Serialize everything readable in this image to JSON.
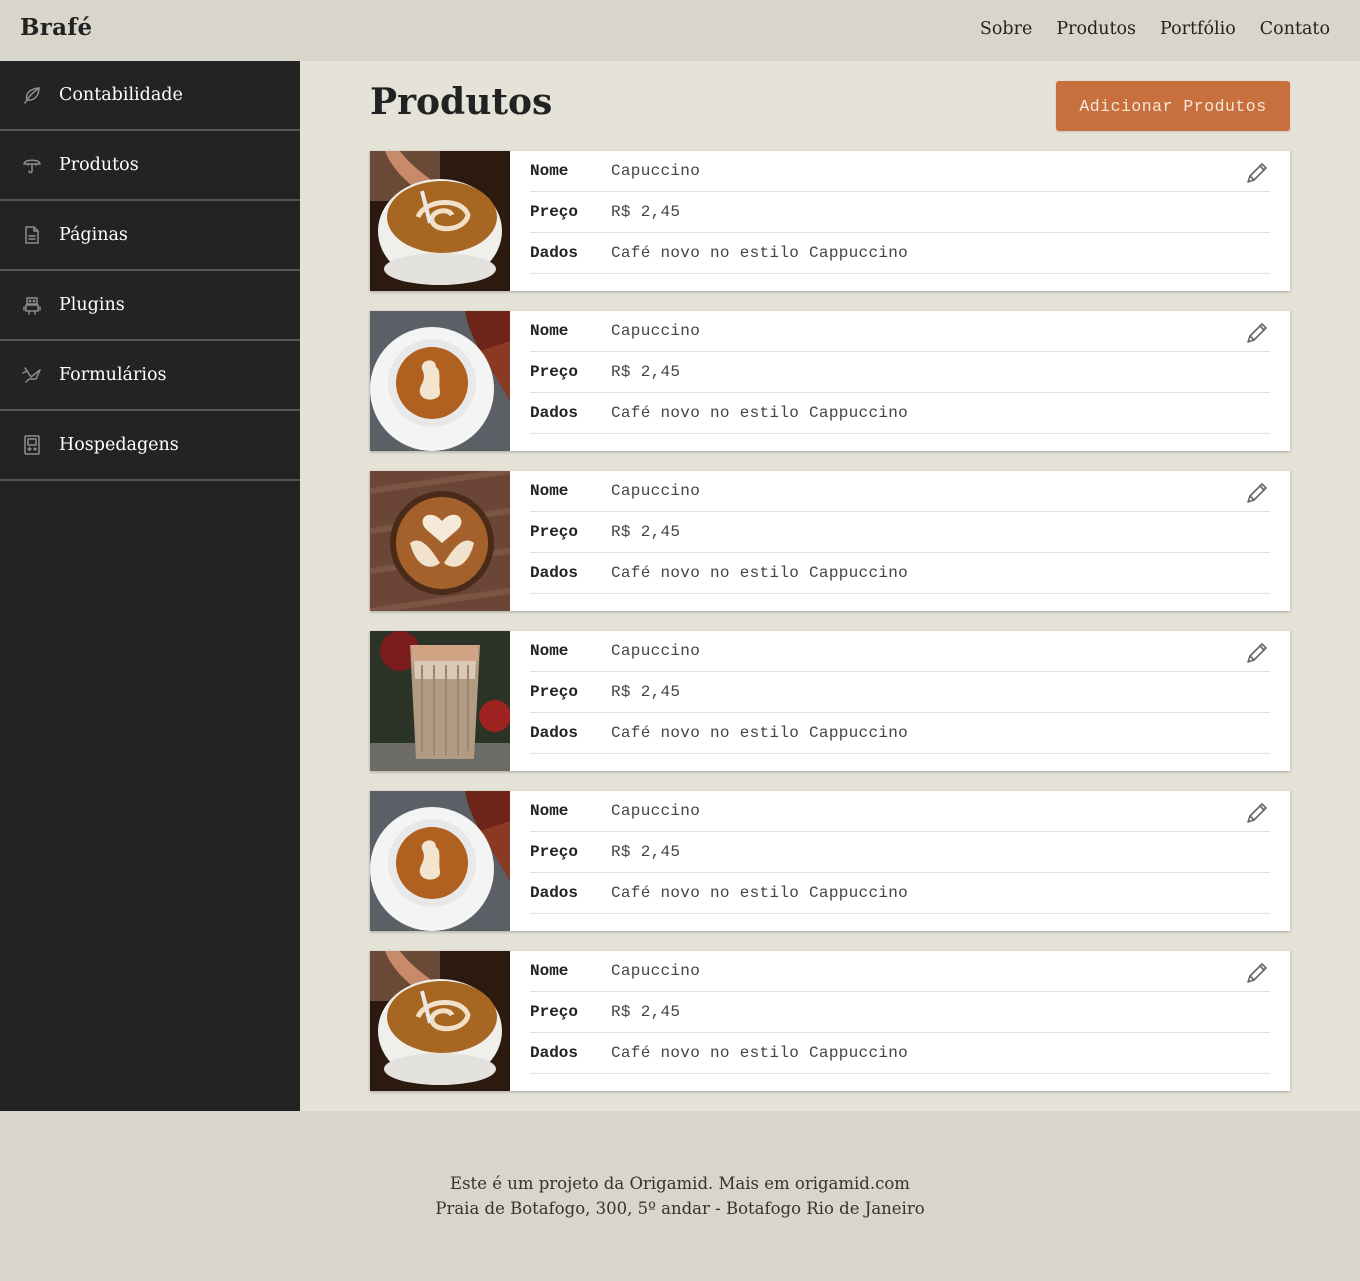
{
  "header": {
    "brand": "Brafé",
    "nav": [
      "Sobre",
      "Produtos",
      "Portfólio",
      "Contato"
    ]
  },
  "sidebar": {
    "items": [
      {
        "label": "Contabilidade",
        "icon": "leaf-icon"
      },
      {
        "label": "Produtos",
        "icon": "umbrella-icon"
      },
      {
        "label": "Páginas",
        "icon": "document-icon"
      },
      {
        "label": "Plugins",
        "icon": "robot-icon"
      },
      {
        "label": "Formulários",
        "icon": "bird-icon"
      },
      {
        "label": "Hospedagens",
        "icon": "gameboy-icon"
      }
    ]
  },
  "main": {
    "title": "Produtos",
    "add_button": "Adicionar Produtos",
    "field_labels": {
      "name": "Nome",
      "price": "Preço",
      "data": "Dados"
    },
    "products": [
      {
        "name": "Capuccino",
        "price": "R$ 2,45",
        "data": "Café novo no estilo Cappuccino",
        "image": "latte-art-pour"
      },
      {
        "name": "Capuccino",
        "price": "R$ 2,45",
        "data": "Café novo no estilo Cappuccino",
        "image": "latte-saucer"
      },
      {
        "name": "Capuccino",
        "price": "R$ 2,45",
        "data": "Café novo no estilo Cappuccino",
        "image": "latte-heart-wood"
      },
      {
        "name": "Capuccino",
        "price": "R$ 2,45",
        "data": "Café novo no estilo Cappuccino",
        "image": "iced-latte-glass"
      },
      {
        "name": "Capuccino",
        "price": "R$ 2,45",
        "data": "Café novo no estilo Cappuccino",
        "image": "latte-saucer"
      },
      {
        "name": "Capuccino",
        "price": "R$ 2,45",
        "data": "Café novo no estilo Cappuccino",
        "image": "latte-art-pour"
      }
    ]
  },
  "footer": {
    "line1": "Este é um projeto da Origamid. Mais em origamid.com",
    "line2": "Praia de Botafogo, 300, 5º andar - Botafogo Rio de Janeiro"
  },
  "colors": {
    "background": "#e5e3d8",
    "topbar": "#d8d5ca",
    "sidebar": "#232323",
    "accent": "#c8703d"
  }
}
